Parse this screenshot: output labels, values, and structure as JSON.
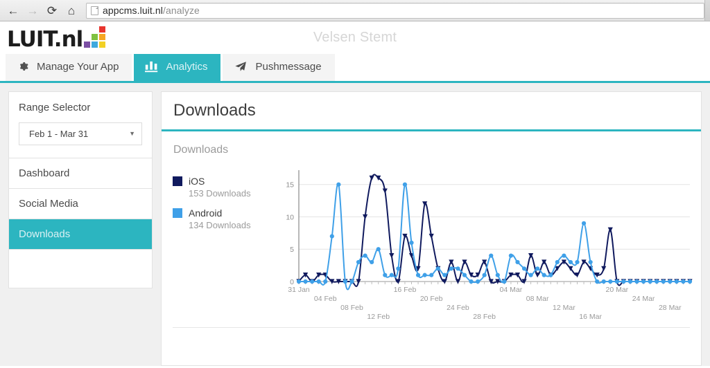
{
  "browser": {
    "back_icon": "back-arrow-icon",
    "forward_icon": "forward-arrow-icon",
    "reload_label": "⟳",
    "home_label": "⌂",
    "back_label": "←",
    "forward_label": "→",
    "url_host": "appcms.luit.nl",
    "url_path": "/analyze",
    "url_full": "appcms.luit.nl/analyze"
  },
  "header": {
    "logo_text": "LUIT.nl",
    "app_title": "Velsen Stemt",
    "logo_block_colors": [
      "",
      "",
      "#e8352e",
      "",
      "#7fc241",
      "#f6a623",
      "#7b4ea3",
      "#3fa9dd",
      "#f2d024"
    ]
  },
  "tabs": [
    {
      "label": "Manage Your App",
      "icon": "gear-icon",
      "active": false
    },
    {
      "label": "Analytics",
      "icon": "bar-chart-icon",
      "active": true
    },
    {
      "label": "Pushmessage",
      "icon": "paper-plane-icon",
      "active": false
    }
  ],
  "sidebar": {
    "range_title": "Range Selector",
    "range_value": "Feb 1 - Mar 31",
    "range_caret": "▼",
    "items": [
      {
        "label": "Dashboard",
        "active": false
      },
      {
        "label": "Social Media",
        "active": false
      },
      {
        "label": "Downloads",
        "active": true
      }
    ]
  },
  "main": {
    "title": "Downloads",
    "subtitle": "Downloads"
  },
  "colors": {
    "accent_teal": "#2cb5c0",
    "ios_navy": "#101a5e",
    "android_blue": "#3fa0e8",
    "grid": "#e4e4e4",
    "axis": "#9a9a9a"
  },
  "chart_data": {
    "type": "line",
    "title": "Downloads",
    "xlabel": "",
    "ylabel": "",
    "ylim": [
      0,
      17
    ],
    "yticks": [
      0,
      5,
      10,
      15
    ],
    "grid": true,
    "legend_position": "left",
    "x_tick_labels": [
      "31 Jan",
      "04 Feb",
      "08 Feb",
      "12 Feb",
      "16 Feb",
      "20 Feb",
      "24 Feb",
      "28 Feb",
      "04 Mar",
      "08 Mar",
      "12 Mar",
      "16 Mar",
      "20 Mar",
      "24 Mar",
      "28 Mar"
    ],
    "x_tick_indices": [
      0,
      4,
      8,
      12,
      16,
      20,
      24,
      28,
      32,
      36,
      40,
      44,
      48,
      52,
      56
    ],
    "x": [
      "31 Jan",
      "01 Feb",
      "02 Feb",
      "03 Feb",
      "04 Feb",
      "05 Feb",
      "06 Feb",
      "07 Feb",
      "08 Feb",
      "09 Feb",
      "10 Feb",
      "11 Feb",
      "12 Feb",
      "13 Feb",
      "14 Feb",
      "15 Feb",
      "16 Feb",
      "17 Feb",
      "18 Feb",
      "19 Feb",
      "20 Feb",
      "21 Feb",
      "22 Feb",
      "23 Feb",
      "24 Feb",
      "25 Feb",
      "26 Feb",
      "27 Feb",
      "28 Feb",
      "01 Mar",
      "02 Mar",
      "03 Mar",
      "04 Mar",
      "05 Mar",
      "06 Mar",
      "07 Mar",
      "08 Mar",
      "09 Mar",
      "10 Mar",
      "11 Mar",
      "12 Mar",
      "13 Mar",
      "14 Mar",
      "15 Mar",
      "16 Mar",
      "17 Mar",
      "18 Mar",
      "19 Mar",
      "20 Mar",
      "21 Mar",
      "22 Mar",
      "23 Mar",
      "24 Mar",
      "25 Mar",
      "26 Mar",
      "27 Mar",
      "28 Mar",
      "29 Mar",
      "30 Mar",
      "31 Mar"
    ],
    "series": [
      {
        "name": "iOS",
        "color": "#101a5e",
        "marker": "triangle",
        "total_label": "153 Downloads",
        "total": 153,
        "values": [
          0,
          1,
          0,
          1,
          1,
          0,
          0,
          0,
          0,
          0,
          10,
          16,
          16,
          14,
          4,
          0,
          7,
          4,
          2,
          12,
          7,
          2,
          0,
          3,
          0,
          3,
          1,
          1,
          3,
          0,
          0,
          0,
          1,
          1,
          0,
          4,
          1,
          3,
          1,
          2,
          3,
          2,
          1,
          3,
          2,
          1,
          2,
          8,
          0,
          0,
          0,
          0,
          0,
          0,
          0,
          0,
          0,
          0,
          0,
          0
        ]
      },
      {
        "name": "Android",
        "color": "#3fa0e8",
        "marker": "circle",
        "total_label": "134 Downloads",
        "total": 134,
        "values": [
          0,
          0,
          0,
          0,
          0,
          7,
          15,
          0,
          0,
          3,
          4,
          3,
          5,
          1,
          1,
          2,
          15,
          6,
          1,
          1,
          1,
          2,
          1,
          2,
          2,
          1,
          0,
          0,
          1,
          4,
          1,
          0,
          4,
          3,
          2,
          1,
          2,
          1,
          1,
          3,
          4,
          3,
          3,
          9,
          3,
          0,
          0,
          0,
          0,
          0,
          0,
          0,
          0,
          0,
          0,
          0,
          0,
          0,
          0,
          0
        ]
      }
    ]
  }
}
